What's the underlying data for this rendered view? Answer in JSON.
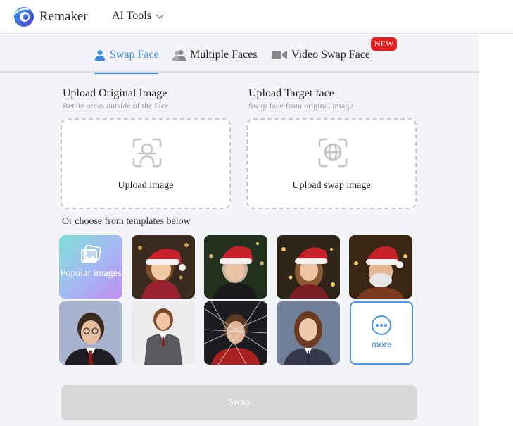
{
  "header": {
    "brand": "Remaker",
    "menu_label": "AI Tools"
  },
  "tabs": [
    {
      "label": "Swap Face",
      "active": true,
      "icon": "user-icon"
    },
    {
      "label": "Multiple Faces",
      "active": false,
      "icon": "users-icon"
    },
    {
      "label": "Video Swap Face",
      "active": false,
      "icon": "video-camera-icon",
      "badge": "NEW"
    }
  ],
  "upload_original": {
    "title": "Upload Original Image",
    "subtitle": "Retain areas outside of the face",
    "button_label": "Upload image",
    "icon": "face-scan-icon"
  },
  "upload_target": {
    "title": "Upload Target face",
    "subtitle": "Swap face from original image",
    "button_label": "Upload swap image",
    "icon": "globe-face-icon"
  },
  "templates": {
    "label": "Or choose from templates below",
    "popular_label": "Popular images",
    "more_label": "more"
  },
  "swap_button": "Swap",
  "colors": {
    "accent": "#3f8ae0",
    "badge": "#e41e1e",
    "panel_bg": "#f3f4f7",
    "disabled_button": "#d8d8d8"
  }
}
